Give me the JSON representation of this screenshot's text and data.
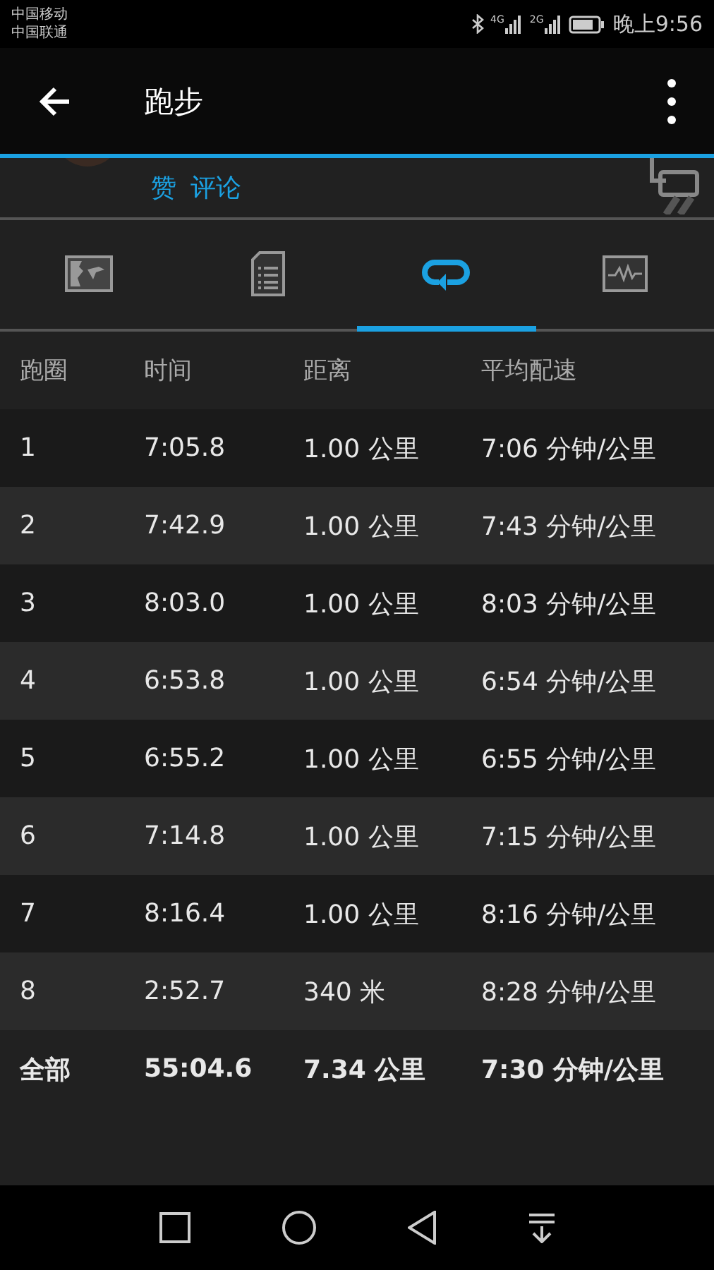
{
  "status_bar": {
    "carriers": [
      "中国移动",
      "中国联通"
    ],
    "network_1": "4G",
    "network_2": "2G",
    "time": "晚上9:56"
  },
  "app_bar": {
    "title": "跑步"
  },
  "social": {
    "like": "赞",
    "comment": "评论"
  },
  "tabs": [
    {
      "kind": "map",
      "selected": false
    },
    {
      "kind": "details",
      "selected": false
    },
    {
      "kind": "laps",
      "selected": true
    },
    {
      "kind": "chart",
      "selected": false
    }
  ],
  "table": {
    "columns": [
      "跑圈",
      "时间",
      "距离",
      "平均配速"
    ],
    "rows": [
      [
        "1",
        "7:05.8",
        "1.00 公里",
        "7:06 分钟/公里"
      ],
      [
        "2",
        "7:42.9",
        "1.00 公里",
        "7:43 分钟/公里"
      ],
      [
        "3",
        "8:03.0",
        "1.00 公里",
        "8:03 分钟/公里"
      ],
      [
        "4",
        "6:53.8",
        "1.00 公里",
        "6:54 分钟/公里"
      ],
      [
        "5",
        "6:55.2",
        "1.00 公里",
        "6:55 分钟/公里"
      ],
      [
        "6",
        "7:14.8",
        "1.00 公里",
        "7:15 分钟/公里"
      ],
      [
        "7",
        "8:16.4",
        "1.00 公里",
        "8:16 分钟/公里"
      ],
      [
        "8",
        "2:52.7",
        "340 米",
        "8:28 分钟/公里"
      ]
    ],
    "total": [
      "全部",
      "55:04.6",
      "7.34 公里",
      "7:30 分钟/公里"
    ]
  }
}
